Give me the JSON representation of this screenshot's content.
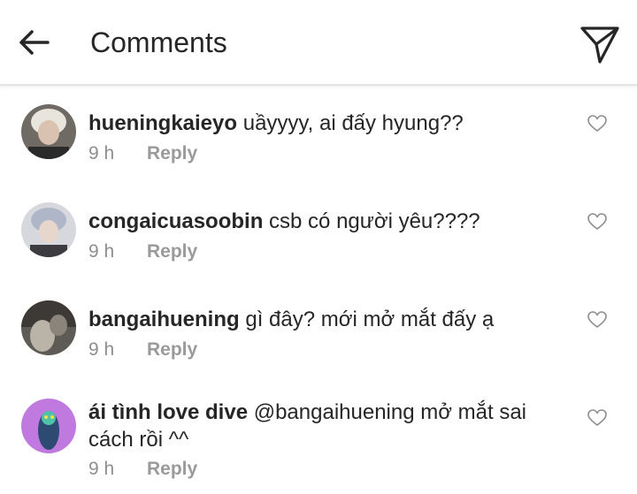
{
  "header": {
    "title": "Comments"
  },
  "comments": [
    {
      "username": "hueningkaieyo",
      "text": "uầyyyy, ai đấy hyung??",
      "time": "9 h",
      "reply_label": "Reply"
    },
    {
      "username": "congaicuasoobin",
      "text": "csb có người yêu????",
      "time": "9 h",
      "reply_label": "Reply"
    },
    {
      "username": "bangaihuening",
      "text": "gì đây? mới mở mắt đấy ạ",
      "time": "9 h",
      "reply_label": "Reply"
    },
    {
      "username": "ái tình love dive",
      "text": "@bangaihuening mở mắt sai cách rồi ^^",
      "time": "9 h",
      "reply_label": "Reply"
    }
  ],
  "icons": {
    "back": "arrow-left-icon",
    "send": "send-icon",
    "like": "heart-outline-icon"
  }
}
